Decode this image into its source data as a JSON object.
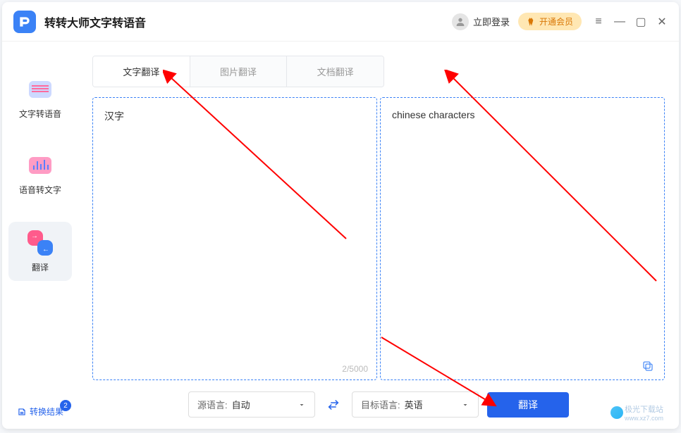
{
  "app": {
    "title": "转转大师文字转语音"
  },
  "titlebar": {
    "login": "立即登录",
    "vip": "开通会员"
  },
  "sidebar": {
    "items": [
      {
        "label": "文字转语音"
      },
      {
        "label": "语音转文字"
      },
      {
        "label": "翻译"
      }
    ],
    "results": "转换结果",
    "badge": "2"
  },
  "tabs": [
    {
      "label": "文字翻译",
      "active": true
    },
    {
      "label": "图片翻译",
      "active": false
    },
    {
      "label": "文档翻译",
      "active": false
    }
  ],
  "source": {
    "text": "汉字",
    "counter": "2/5000"
  },
  "target": {
    "text": "chinese characters"
  },
  "footer": {
    "srcLangLabel": "源语言:",
    "srcLangValue": "自动",
    "dstLangLabel": "目标语言:",
    "dstLangValue": "英语",
    "button": "翻译"
  },
  "watermark": {
    "text": "极光下载站",
    "url": "www.xz7.com"
  }
}
